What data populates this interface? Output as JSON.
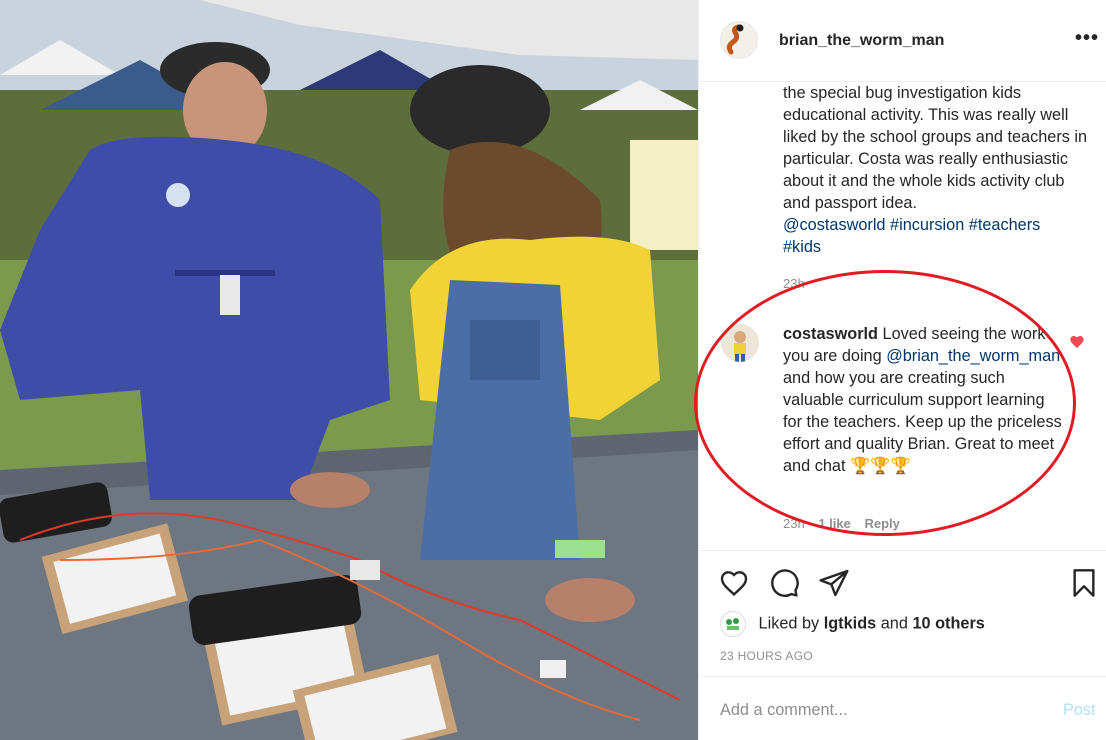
{
  "post": {
    "username": "brian_the_worm_man",
    "more_label": "•••"
  },
  "caption": {
    "text": "the special bug investigation kids educational activity. This was really well liked by the school groups and teachers in particular. Costa was really enthusiastic about it and the whole kids activity club and passport idea.",
    "mention": "@costasworld",
    "tags": [
      "#incursion",
      "#teachers",
      "#kids"
    ],
    "time": "23h"
  },
  "comment": {
    "username": "costasworld",
    "text_before": "Loved seeing the work you are doing",
    "mention": "@brian_the_worm_man",
    "text_after": "and how you are creating such valuable curriculum support learning for the teachers. Keep up the priceless effort and quality Brian. Great to meet and chat",
    "trophies": "🏆🏆🏆",
    "time": "23h",
    "likes": "1 like",
    "reply": "Reply"
  },
  "engagement": {
    "liked_by_prefix": "Liked by",
    "liked_by_user": "lgtkids",
    "liked_by_and": "and",
    "others": "10 others",
    "timestamp": "23 HOURS AGO"
  },
  "composer": {
    "placeholder": "Add a comment...",
    "post_label": "Post"
  },
  "colors": {
    "annotation": "#e01b24",
    "link": "#00376b",
    "heart": "#ed4956",
    "post_disabled": "#b2dffc"
  },
  "icons": [
    "worm-avatar-icon",
    "heart-icon",
    "comment-icon",
    "share-icon",
    "bookmark-icon"
  ]
}
